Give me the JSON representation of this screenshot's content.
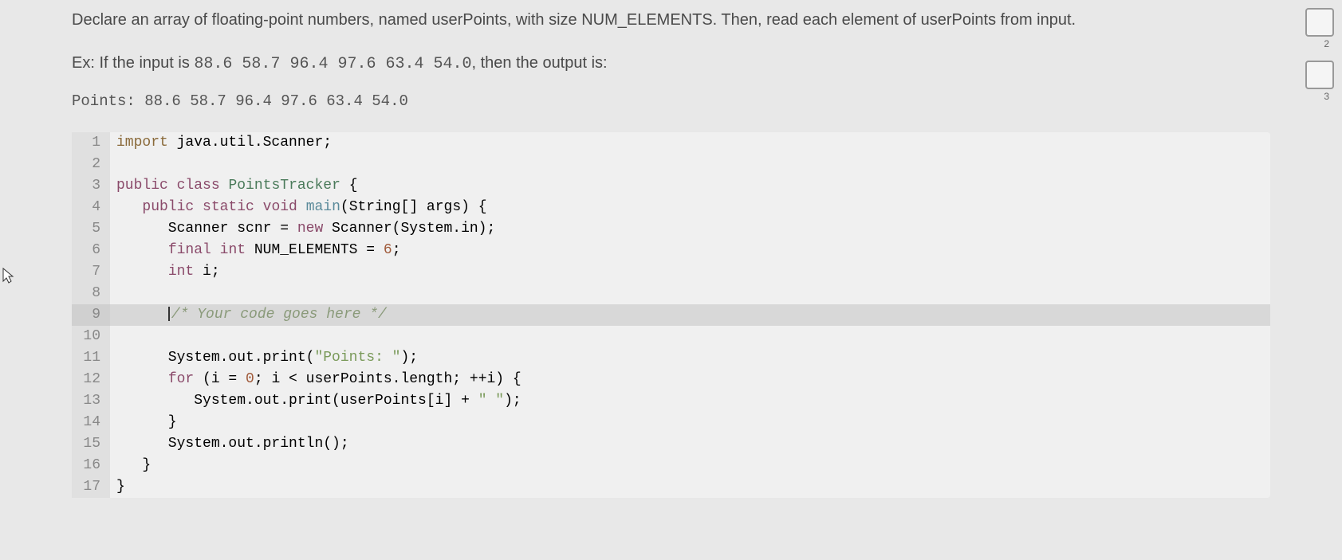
{
  "problem": {
    "description": "Declare an array of floating-point numbers, named userPoints, with size NUM_ELEMENTS. Then, read each element of userPoints from input.",
    "example_prefix": "Ex: If the input is ",
    "example_input": "88.6 58.7 96.4 97.6 63.4 54.0",
    "example_suffix": ", then the output is:",
    "output_label": "Points: 88.6 58.7 96.4 97.6 63.4 54.0"
  },
  "code": {
    "lines": [
      {
        "num": "1",
        "text": "import java.util.Scanner;"
      },
      {
        "num": "2",
        "text": ""
      },
      {
        "num": "3",
        "text": "public class PointsTracker {"
      },
      {
        "num": "4",
        "text": "   public static void main(String[] args) {"
      },
      {
        "num": "5",
        "text": "      Scanner scnr = new Scanner(System.in);"
      },
      {
        "num": "6",
        "text": "      final int NUM_ELEMENTS = 6;"
      },
      {
        "num": "7",
        "text": "      int i;"
      },
      {
        "num": "8",
        "text": ""
      },
      {
        "num": "9",
        "text": "      /* Your code goes here */"
      },
      {
        "num": "10",
        "text": ""
      },
      {
        "num": "11",
        "text": "      System.out.print(\"Points: \");"
      },
      {
        "num": "12",
        "text": "      for (i = 0; i < userPoints.length; ++i) {"
      },
      {
        "num": "13",
        "text": "         System.out.print(userPoints[i] + \" \");"
      },
      {
        "num": "14",
        "text": "      }"
      },
      {
        "num": "15",
        "text": "      System.out.println();"
      },
      {
        "num": "16",
        "text": "   }"
      },
      {
        "num": "17",
        "text": "}"
      }
    ]
  },
  "sidebar": {
    "box2_label": "2",
    "box3_label": "3"
  }
}
